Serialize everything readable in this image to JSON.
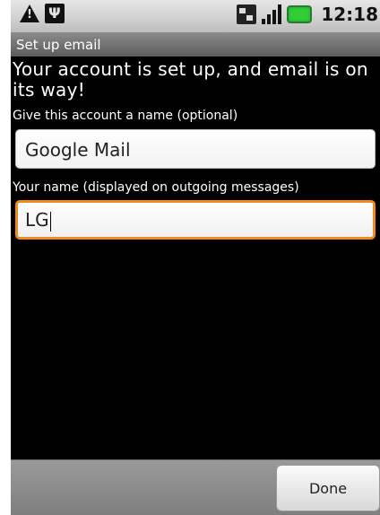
{
  "status_bar": {
    "time": "12:18",
    "icons": [
      "warning-icon",
      "usb-icon",
      "network-icon",
      "signal-icon",
      "battery-icon"
    ],
    "battery_color": "#33cc33"
  },
  "title_bar": {
    "title": "Set up email"
  },
  "content": {
    "headline": "Your account is set up, and email is on its way!",
    "account_name_label": "Give this account a name (optional)",
    "account_name_value": "Google Mail",
    "your_name_label": "Your name (displayed on outgoing messages)",
    "your_name_value": "LG",
    "focus_color": "#f08a1c"
  },
  "bottom_bar": {
    "done_label": "Done"
  }
}
